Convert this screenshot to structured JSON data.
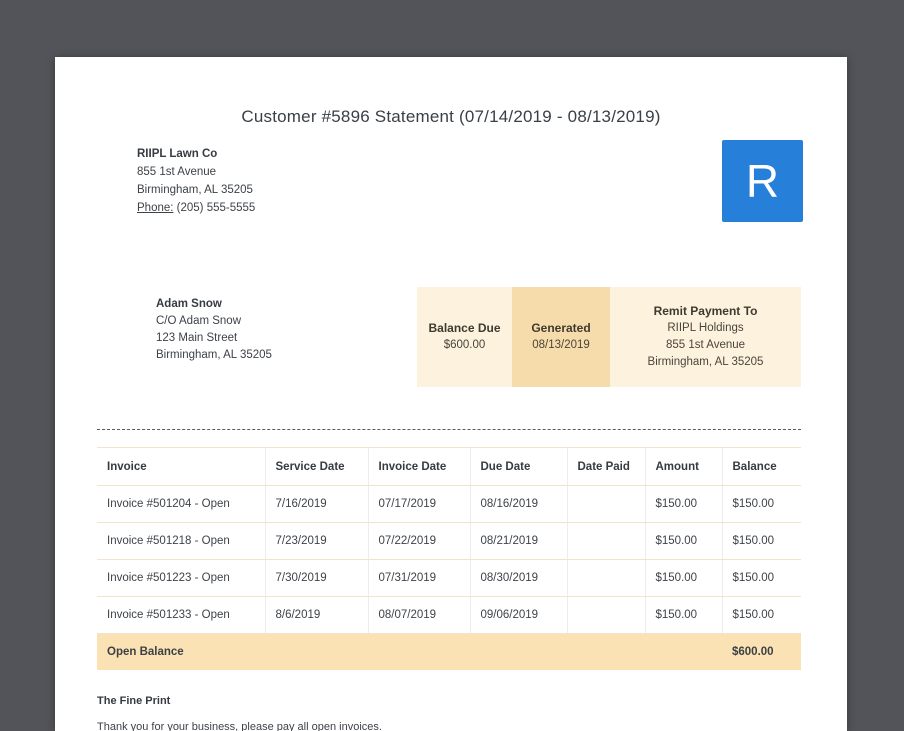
{
  "page": {
    "title": "Customer #5896 Statement (07/14/2019 - 08/13/2019)"
  },
  "company": {
    "name": "RIIPL Lawn Co",
    "address_line1": "855 1st Avenue",
    "address_line2": "Birmingham, AL 35205",
    "phone_label": "Phone:",
    "phone_number": "(205) 555-5555",
    "logo_letter": "R"
  },
  "customer": {
    "name": "Adam Snow",
    "care_of": "C/O Adam Snow",
    "address_line1": "123 Main Street",
    "address_line2": "Birmingham, AL 35205"
  },
  "summary": {
    "balance_due_label": "Balance Due",
    "balance_due_value": "$600.00",
    "generated_label": "Generated",
    "generated_value": "08/13/2019",
    "remit_label": "Remit Payment To",
    "remit_name": "RIIPL Holdings",
    "remit_address1": "855 1st Avenue",
    "remit_address2": "Birmingham, AL 35205"
  },
  "table": {
    "headers": [
      "Invoice",
      "Service Date",
      "Invoice Date",
      "Due Date",
      "Date Paid",
      "Amount",
      "Balance"
    ],
    "rows": [
      {
        "invoice": "Invoice #501204 - Open",
        "service_date": "7/16/2019",
        "invoice_date": "07/17/2019",
        "due_date": "08/16/2019",
        "date_paid": "",
        "amount": "$150.00",
        "balance": "$150.00"
      },
      {
        "invoice": "Invoice #501218 - Open",
        "service_date": "7/23/2019",
        "invoice_date": "07/22/2019",
        "due_date": "08/21/2019",
        "date_paid": "",
        "amount": "$150.00",
        "balance": "$150.00"
      },
      {
        "invoice": "Invoice #501223 - Open",
        "service_date": "7/30/2019",
        "invoice_date": "07/31/2019",
        "due_date": "08/30/2019",
        "date_paid": "",
        "amount": "$150.00",
        "balance": "$150.00"
      },
      {
        "invoice": "Invoice #501233 - Open",
        "service_date": "8/6/2019",
        "invoice_date": "08/07/2019",
        "due_date": "09/06/2019",
        "date_paid": "",
        "amount": "$150.00",
        "balance": "$150.00"
      }
    ],
    "footer": {
      "label": "Open Balance",
      "total": "$600.00"
    }
  },
  "fine_print": {
    "heading": "The Fine Print",
    "text": "Thank you for your business, please pay all open invoices."
  },
  "colors": {
    "accent_blue": "#2680d9",
    "peach_light": "#fcf2de",
    "peach_medium": "#f7dcab",
    "open_balance_row": "#fbe2b4",
    "background": "#535459"
  }
}
